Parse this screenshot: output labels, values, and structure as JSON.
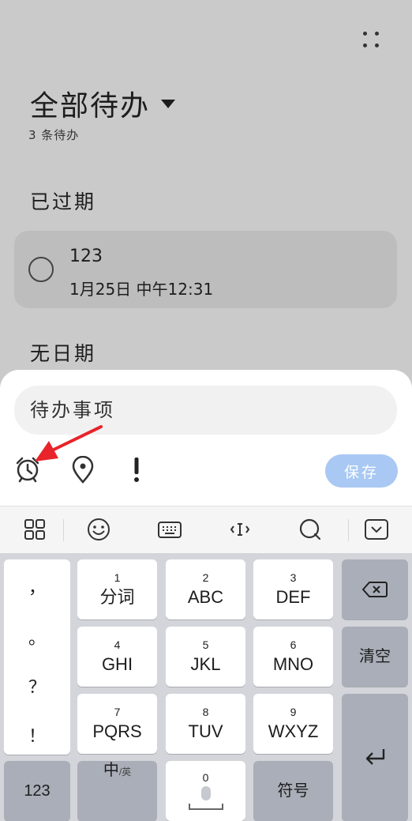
{
  "app": {
    "title": "全部待办",
    "count_text": "3 条待办",
    "sections": {
      "overdue": "已过期",
      "no_date": "无日期"
    },
    "overdue_item": {
      "title": "123",
      "time": "1月25日 中午12:31"
    }
  },
  "sheet": {
    "input_placeholder": "待办事项",
    "save_label": "保存",
    "icons": [
      "alarm-icon",
      "location-pin-icon",
      "priority-icon"
    ]
  },
  "keyboard": {
    "toolbar_icons": [
      "grid-icon",
      "emoji-icon",
      "keyboard-icon",
      "cursor-icon",
      "search-icon",
      "collapse-keyboard-icon"
    ],
    "punctuation": [
      "，",
      "。",
      "？",
      "！"
    ],
    "keys": {
      "k1": {
        "num": "1",
        "label": "分词"
      },
      "k2": {
        "num": "2",
        "label": "ABC"
      },
      "k3": {
        "num": "3",
        "label": "DEF"
      },
      "k4": {
        "num": "4",
        "label": "GHI"
      },
      "k5": {
        "num": "5",
        "label": "JKL"
      },
      "k6": {
        "num": "6",
        "label": "MNO"
      },
      "k7": {
        "num": "7",
        "label": "PQRS"
      },
      "k8": {
        "num": "8",
        "label": "TUV"
      },
      "k9": {
        "num": "9",
        "label": "WXYZ"
      },
      "space_num": "0"
    },
    "clear_label": "清空",
    "num_switch_label": "123",
    "lang_main": "中",
    "lang_sub": "/英",
    "symbols_label": "符号"
  },
  "colors": {
    "save_button": "#a9c8f3",
    "arrow": "#e8232a"
  }
}
